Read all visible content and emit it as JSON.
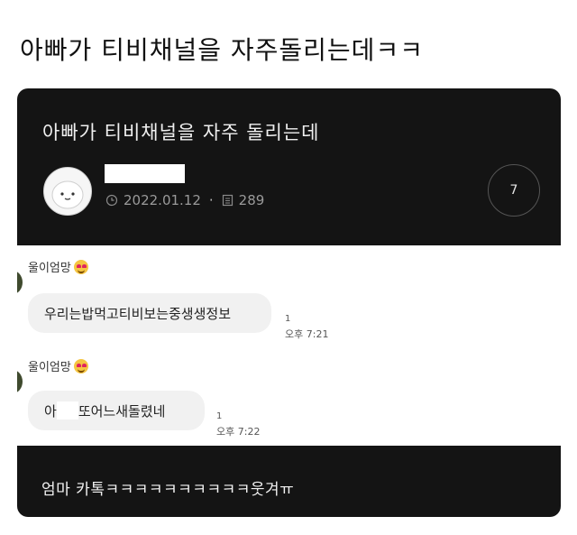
{
  "page_title": "아빠가 티비채널을 자주돌리는데ㅋㅋ",
  "post": {
    "title": "아빠가 티비채널을 자주 돌리는데",
    "date": "2022.01.12",
    "views": "289",
    "comment_count": "7",
    "icons": {
      "date": "clock-icon",
      "views": "document-icon"
    }
  },
  "chat": {
    "messages": [
      {
        "sender": "울이엄망",
        "text": "우리는밥먹고티비보는중생생정보",
        "read": "1",
        "time": "오후 7:21"
      },
      {
        "sender": "울이엄망",
        "text_before": "아",
        "text_after": "또어느새돌렸네",
        "read": "1",
        "time": "오후 7:22"
      }
    ]
  },
  "caption": "엄마 카톡ㅋㅋㅋㅋㅋㅋㅋㅋㅋㅋ웃겨ㅠ",
  "colors": {
    "card_bg": "#141414",
    "bubble_bg": "#f1f1f1",
    "page_bg": "#ffffff"
  }
}
